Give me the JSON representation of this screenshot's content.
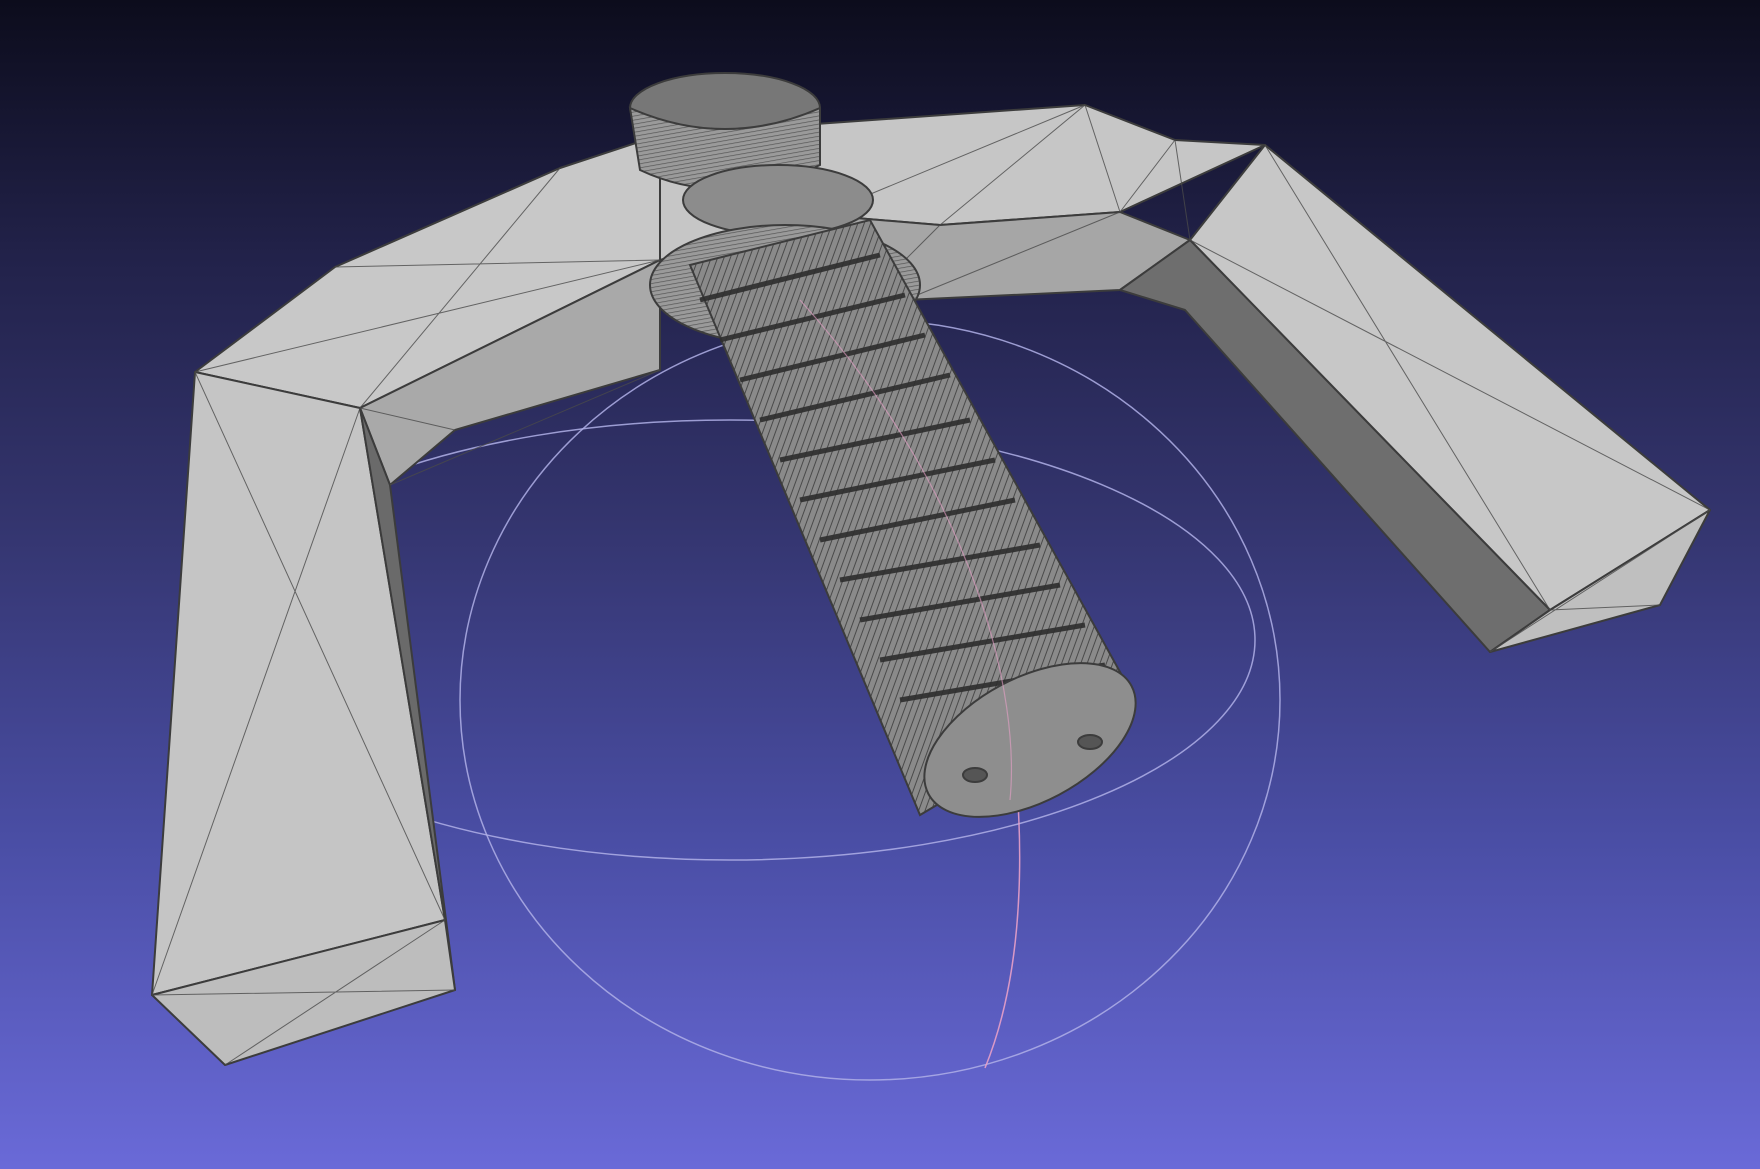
{
  "app": {
    "title": "",
    "colors": {
      "background_top": "#0c0c1c",
      "background_bottom": "#6a6ad8",
      "mesh_face_light": "#c4c4c4",
      "mesh_face_mid": "#a7a7a7",
      "mesh_face_dark": "#6b6b6b",
      "mesh_edge": "#3c3c3c",
      "trackball_circle": "#b0b0e8",
      "trackball_axis": "#e8a0c8"
    }
  },
  "viewport": {
    "content": "3d-mesh-wireframe-overlay",
    "model": "wing-screw-part",
    "trackball": {
      "visible": true
    }
  }
}
